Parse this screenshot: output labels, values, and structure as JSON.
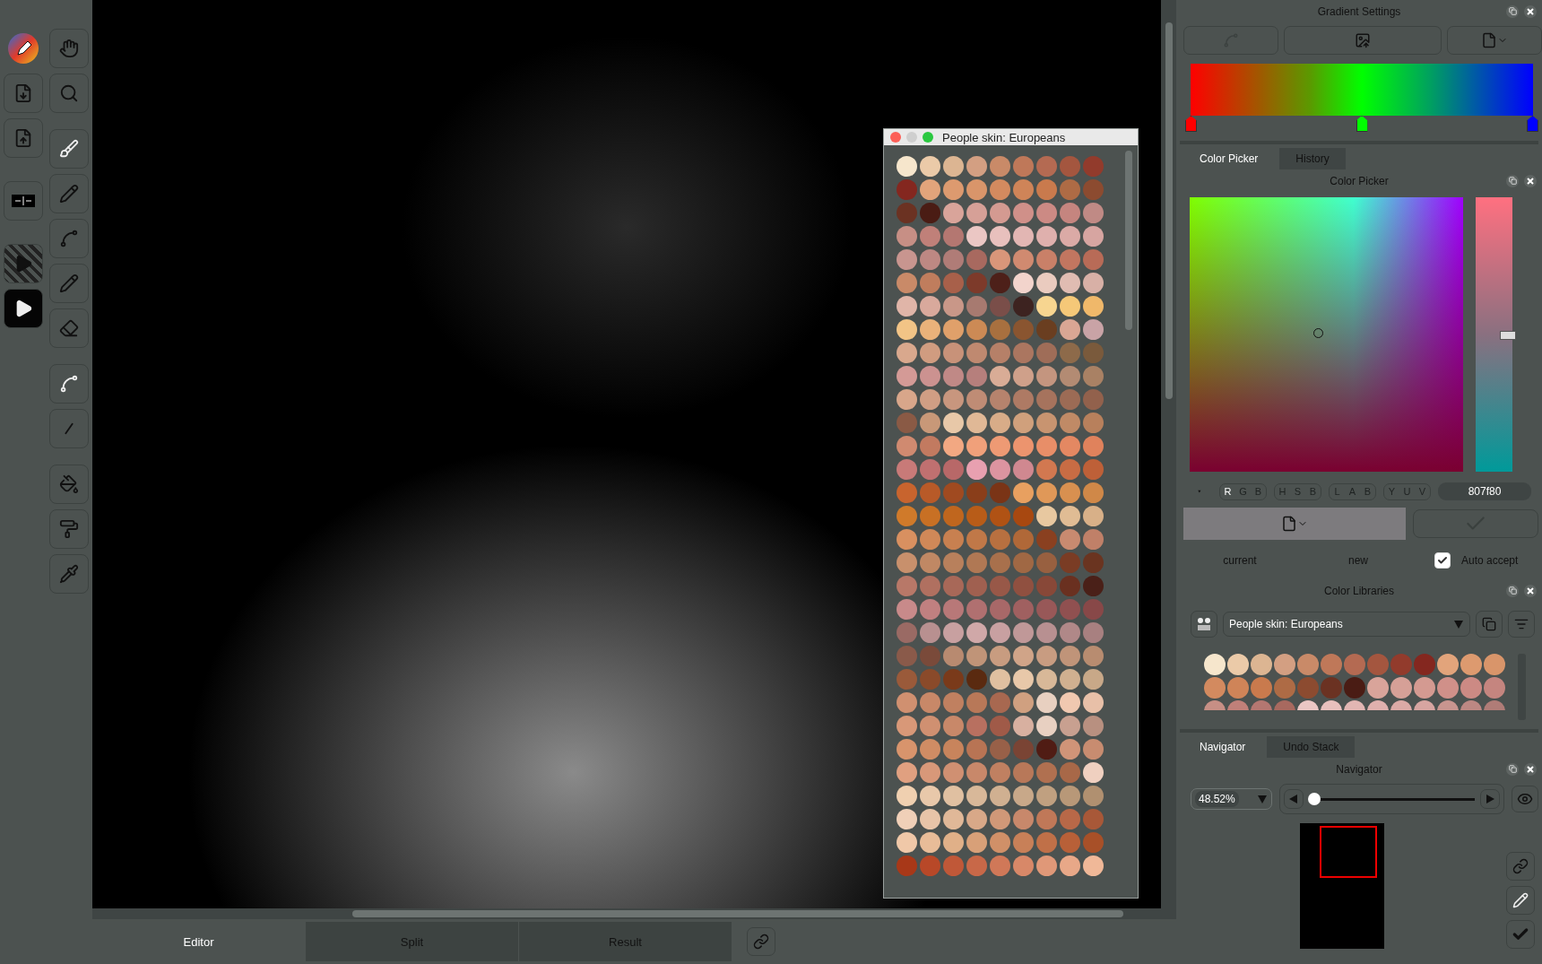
{
  "palette_window": {
    "title": "People skin: Europeans",
    "swatches": [
      {
        "color": "#f6e6cc"
      },
      {
        "color": "#ebcaa8"
      },
      {
        "color": "#dcb592"
      },
      {
        "color": "#d39f82"
      },
      {
        "color": "#c98a68"
      },
      {
        "color": "#bf7859"
      },
      {
        "color": "#b46a52"
      },
      {
        "color": "#a4563f"
      },
      {
        "color": "#923b2c"
      },
      {
        "color": "#84271f"
      },
      {
        "color": "#e2a47b"
      },
      {
        "color": "#dd9a6f"
      },
      {
        "color": "#d9956a"
      },
      {
        "color": "#d38a5f"
      },
      {
        "color": "#cf8458"
      },
      {
        "color": "#c97a4d"
      },
      {
        "color": "#ae6b45"
      },
      {
        "color": "#8c4b30"
      },
      {
        "color": "#6b3222"
      },
      {
        "color": "#4a1c14"
      },
      {
        "color": "#d9a49a"
      },
      {
        "color": "#d6a097"
      },
      {
        "color": "#d49a91"
      },
      {
        "color": "#d09089"
      },
      {
        "color": "#cc8a84"
      },
      {
        "color": "#c5857f"
      },
      {
        "color": "#c08a85"
      },
      {
        "color": "#c78f85"
      },
      {
        "color": "#c08079"
      },
      {
        "color": "#b47771"
      },
      {
        "color": "#ebc7c4"
      },
      {
        "color": "#e8c0bd"
      },
      {
        "color": "#e2b6b3"
      },
      {
        "color": "#dfb0ad"
      },
      {
        "color": "#dbaaa6"
      },
      {
        "color": "#d7a5a1"
      },
      {
        "color": "#c8958f"
      },
      {
        "color": "#bd8883"
      },
      {
        "color": "#b07c77"
      },
      {
        "color": "#a8695f"
      },
      {
        "color": "#d9967a"
      },
      {
        "color": "#d08a70"
      },
      {
        "color": "#c98068"
      },
      {
        "color": "#c27660"
      },
      {
        "color": "#b86b57"
      },
      {
        "color": "#c98a68"
      },
      {
        "color": "#c07d5d"
      },
      {
        "color": "#a8604a"
      },
      {
        "color": "#7d3a2a"
      },
      {
        "color": "#4d2019"
      },
      {
        "color": "#f2d4cc"
      },
      {
        "color": "#eacbbf"
      },
      {
        "color": "#e0bcb2"
      },
      {
        "color": "#d8b0a6"
      },
      {
        "color": "#e0b5a8"
      },
      {
        "color": "#d9a99c"
      },
      {
        "color": "#c99788"
      },
      {
        "color": "#a77a70"
      },
      {
        "color": "#7a4e49"
      },
      {
        "color": "#3d2320"
      },
      {
        "color": "#f7d590"
      },
      {
        "color": "#f5c878"
      },
      {
        "color": "#f0b86a"
      },
      {
        "color": "#f2c486"
      },
      {
        "color": "#eab27a"
      },
      {
        "color": "#e0a06a"
      },
      {
        "color": "#cc8a55"
      },
      {
        "color": "#a8703f"
      },
      {
        "color": "#8a5530"
      },
      {
        "color": "#6a3e20"
      },
      {
        "color": "#d9a694"
      },
      {
        "color": "#c9a3a6"
      },
      {
        "color": "#d9a88d"
      },
      {
        "color": "#d09c80"
      },
      {
        "color": "#c89279"
      },
      {
        "color": "#bf8970"
      },
      {
        "color": "#b68068"
      },
      {
        "color": "#ab7660"
      },
      {
        "color": "#9f6d58"
      },
      {
        "color": "#8d6a4a"
      },
      {
        "color": "#7a5a3c"
      },
      {
        "color": "#d49a96"
      },
      {
        "color": "#cc9290"
      },
      {
        "color": "#c08986"
      },
      {
        "color": "#b67f7c"
      },
      {
        "color": "#d9ac96"
      },
      {
        "color": "#cfa08a"
      },
      {
        "color": "#c4957f"
      },
      {
        "color": "#b38b73"
      },
      {
        "color": "#a98164"
      },
      {
        "color": "#d8a68a"
      },
      {
        "color": "#d09e84"
      },
      {
        "color": "#c8967e"
      },
      {
        "color": "#bf8c75"
      },
      {
        "color": "#b6836d"
      },
      {
        "color": "#ae7a64"
      },
      {
        "color": "#a6735d"
      },
      {
        "color": "#9c6b55"
      },
      {
        "color": "#92614c"
      },
      {
        "color": "#8a5a45"
      },
      {
        "color": "#c89878"
      },
      {
        "color": "#e8c8a8"
      },
      {
        "color": "#e0b896"
      },
      {
        "color": "#d8ac88"
      },
      {
        "color": "#d0a07c"
      },
      {
        "color": "#c89470"
      },
      {
        "color": "#c08a66"
      },
      {
        "color": "#b8805c"
      },
      {
        "color": "#d08a70"
      },
      {
        "color": "#c27a60"
      },
      {
        "color": "#f2a882"
      },
      {
        "color": "#f0a07a"
      },
      {
        "color": "#ee9a74"
      },
      {
        "color": "#ec946e"
      },
      {
        "color": "#e88e68"
      },
      {
        "color": "#e48862"
      },
      {
        "color": "#e0825c"
      },
      {
        "color": "#c87a78"
      },
      {
        "color": "#c07070"
      },
      {
        "color": "#b86868"
      },
      {
        "color": "#e8a0b0"
      },
      {
        "color": "#dc94a0"
      },
      {
        "color": "#d08890"
      },
      {
        "color": "#d27850"
      },
      {
        "color": "#c86c44"
      },
      {
        "color": "#be6038"
      },
      {
        "color": "#c8642e"
      },
      {
        "color": "#b85a28"
      },
      {
        "color": "#a04a20"
      },
      {
        "color": "#8a3e1a"
      },
      {
        "color": "#7a3416"
      },
      {
        "color": "#e8a060"
      },
      {
        "color": "#e09858"
      },
      {
        "color": "#d89050"
      },
      {
        "color": "#d08848"
      },
      {
        "color": "#d07a2a"
      },
      {
        "color": "#c87024"
      },
      {
        "color": "#c0661e"
      },
      {
        "color": "#b85c18"
      },
      {
        "color": "#b05214"
      },
      {
        "color": "#a84810"
      },
      {
        "color": "#e8c8a0"
      },
      {
        "color": "#e0bc94"
      },
      {
        "color": "#d8b088"
      },
      {
        "color": "#d89060"
      },
      {
        "color": "#d08858"
      },
      {
        "color": "#c88050"
      },
      {
        "color": "#c07848"
      },
      {
        "color": "#b87040"
      },
      {
        "color": "#b06838"
      },
      {
        "color": "#8a4020"
      },
      {
        "color": "#c88a70"
      },
      {
        "color": "#c08068"
      },
      {
        "color": "#c8906c"
      },
      {
        "color": "#c08864"
      },
      {
        "color": "#b8805c"
      },
      {
        "color": "#b07854"
      },
      {
        "color": "#a8704c"
      },
      {
        "color": "#a06844"
      },
      {
        "color": "#986040"
      },
      {
        "color": "#7a3c24"
      },
      {
        "color": "#6a3420"
      },
      {
        "color": "#b87868"
      },
      {
        "color": "#b07060"
      },
      {
        "color": "#a86858"
      },
      {
        "color": "#a06050"
      },
      {
        "color": "#985848"
      },
      {
        "color": "#905040"
      },
      {
        "color": "#884838"
      },
      {
        "color": "#6a3020"
      },
      {
        "color": "#4a2018"
      },
      {
        "color": "#c88a8a"
      },
      {
        "color": "#c08080"
      },
      {
        "color": "#b87878"
      },
      {
        "color": "#b07070"
      },
      {
        "color": "#a86868"
      },
      {
        "color": "#a06060"
      },
      {
        "color": "#985858"
      },
      {
        "color": "#905050"
      },
      {
        "color": "#884848"
      },
      {
        "color": "#9a6a64"
      },
      {
        "color": "#b89090"
      },
      {
        "color": "#c8a0a0"
      },
      {
        "color": "#d0a8a8"
      },
      {
        "color": "#c8a0a1"
      },
      {
        "color": "#c09898"
      },
      {
        "color": "#b89091"
      },
      {
        "color": "#b08888"
      },
      {
        "color": "#a88080"
      },
      {
        "color": "#8a5a4a"
      },
      {
        "color": "#7a4a3a"
      },
      {
        "color": "#b88a70"
      },
      {
        "color": "#c09478"
      },
      {
        "color": "#c89c80"
      },
      {
        "color": "#d0a488"
      },
      {
        "color": "#c89c81"
      },
      {
        "color": "#c09479"
      },
      {
        "color": "#b88c70"
      },
      {
        "color": "#9a5a3a"
      },
      {
        "color": "#8a4a2a"
      },
      {
        "color": "#7a3a1a"
      },
      {
        "color": "#5a2a10"
      },
      {
        "color": "#e0c0a0"
      },
      {
        "color": "#e8c8a9"
      },
      {
        "color": "#d8b898"
      },
      {
        "color": "#d0b090"
      },
      {
        "color": "#c8a888"
      },
      {
        "color": "#d09070"
      },
      {
        "color": "#c88868"
      },
      {
        "color": "#c08060"
      },
      {
        "color": "#b87858"
      },
      {
        "color": "#a86850"
      },
      {
        "color": "#d0a080"
      },
      {
        "color": "#e8d0c0"
      },
      {
        "color": "#f0c8b0"
      },
      {
        "color": "#e8c0a8"
      },
      {
        "color": "#d89878"
      },
      {
        "color": "#d09071"
      },
      {
        "color": "#c88869"
      },
      {
        "color": "#b87060"
      },
      {
        "color": "#a05a48"
      },
      {
        "color": "#d8b0a0"
      },
      {
        "color": "#e8d0c1"
      },
      {
        "color": "#c8a090"
      },
      {
        "color": "#b89080"
      },
      {
        "color": "#d8946c"
      },
      {
        "color": "#d08c64"
      },
      {
        "color": "#c8845c"
      },
      {
        "color": "#b87454"
      },
      {
        "color": "#986048"
      },
      {
        "color": "#7a4434"
      },
      {
        "color": "#501c14"
      },
      {
        "color": "#d09478"
      },
      {
        "color": "#c88c70"
      },
      {
        "color": "#e0a080"
      },
      {
        "color": "#d89879"
      },
      {
        "color": "#d09072"
      },
      {
        "color": "#c8886a"
      },
      {
        "color": "#c08061"
      },
      {
        "color": "#b87859"
      },
      {
        "color": "#b07050"
      },
      {
        "color": "#a86848"
      },
      {
        "color": "#f0d0c0"
      },
      {
        "color": "#f0d0b0"
      },
      {
        "color": "#e8c8aa"
      },
      {
        "color": "#e0c0a1"
      },
      {
        "color": "#d8b899"
      },
      {
        "color": "#d0b091"
      },
      {
        "color": "#c8a889"
      },
      {
        "color": "#c0a080"
      },
      {
        "color": "#b89878"
      },
      {
        "color": "#b09070"
      },
      {
        "color": "#f0d0b8"
      },
      {
        "color": "#e8c4a8"
      },
      {
        "color": "#e0b898"
      },
      {
        "color": "#d8a888"
      },
      {
        "color": "#d09878"
      },
      {
        "color": "#c8886b"
      },
      {
        "color": "#c07858"
      },
      {
        "color": "#b86848"
      },
      {
        "color": "#a85838"
      },
      {
        "color": "#f0c8a8"
      },
      {
        "color": "#e8bc98"
      },
      {
        "color": "#e0b088"
      },
      {
        "color": "#d8a078"
      },
      {
        "color": "#d09068"
      },
      {
        "color": "#c88058"
      },
      {
        "color": "#c07048"
      },
      {
        "color": "#b86038"
      },
      {
        "color": "#a85028"
      },
      {
        "color": "#a83818"
      },
      {
        "color": "#b84828"
      },
      {
        "color": "#c05838"
      },
      {
        "color": "#c86848"
      },
      {
        "color": "#d07858"
      },
      {
        "color": "#d88868"
      },
      {
        "color": "#e09878"
      },
      {
        "color": "#e8a888"
      },
      {
        "color": "#f0b898"
      }
    ]
  },
  "view_tabs": [
    {
      "label": "Editor",
      "selected": true
    },
    {
      "label": "Split",
      "selected": false
    },
    {
      "label": "Result",
      "selected": false
    }
  ],
  "gradient_settings": {
    "title": "Gradient Settings",
    "stops": [
      {
        "color": "#ff0000"
      },
      {
        "color": "#00ff00"
      },
      {
        "color": "#0000ff"
      }
    ]
  },
  "color_panel": {
    "tabs": [
      {
        "label": "Color Picker",
        "selected": true
      },
      {
        "label": "History",
        "selected": false
      }
    ],
    "title": "Color Picker",
    "hue_slider": {
      "level": 0.5
    },
    "channel_groups": [
      [
        {
          "label": "R",
          "selected": true
        },
        {
          "label": "G",
          "selected": false
        },
        {
          "label": "B",
          "selected": false
        }
      ],
      [
        {
          "label": "H",
          "selected": false
        },
        {
          "label": "S",
          "selected": false
        },
        {
          "label": "B",
          "selected": false
        }
      ],
      [
        {
          "label": "L",
          "selected": false
        },
        {
          "label": "A",
          "selected": false
        },
        {
          "label": "B",
          "selected": false
        }
      ],
      [
        {
          "label": "Y",
          "selected": false
        },
        {
          "label": "U",
          "selected": false
        },
        {
          "label": "V",
          "selected": false
        }
      ]
    ],
    "hex_value": "807f80",
    "current_label": "current",
    "new_label": "new",
    "auto_accept": {
      "label": "Auto accept",
      "checked": true
    }
  },
  "color_libraries": {
    "title": "Color Libraries",
    "library": "People skin: Europeans",
    "swatches": [
      {
        "color": "#f6e6cc"
      },
      {
        "color": "#ebcaa8"
      },
      {
        "color": "#dcb592"
      },
      {
        "color": "#d39f82"
      },
      {
        "color": "#c98a68"
      },
      {
        "color": "#bf7859"
      },
      {
        "color": "#b46a52"
      },
      {
        "color": "#a4563f"
      },
      {
        "color": "#923b2c"
      },
      {
        "color": "#84271f"
      },
      {
        "color": "#e2a47b"
      },
      {
        "color": "#dd9a6f"
      },
      {
        "color": "#d9956a"
      },
      {
        "color": "#d38a5f"
      },
      {
        "color": "#cf8458"
      },
      {
        "color": "#c97a4d"
      },
      {
        "color": "#ae6b45"
      },
      {
        "color": "#8c4b30"
      },
      {
        "color": "#6b3222"
      },
      {
        "color": "#4a1c14"
      },
      {
        "color": "#d9a49a"
      },
      {
        "color": "#d6a097"
      },
      {
        "color": "#d49a91"
      },
      {
        "color": "#d09089"
      },
      {
        "color": "#cc8a84"
      },
      {
        "color": "#c5857f"
      },
      {
        "color": "#c78f85"
      },
      {
        "color": "#c08079"
      },
      {
        "color": "#b47771"
      },
      {
        "color": "#a8695f"
      },
      {
        "color": "#ebc7c4"
      },
      {
        "color": "#e8c0bd"
      },
      {
        "color": "#e2b6b3"
      },
      {
        "color": "#dfb0ad"
      },
      {
        "color": "#dbaaa6"
      },
      {
        "color": "#d7a5a1"
      },
      {
        "color": "#c8958f"
      },
      {
        "color": "#bd8883"
      },
      {
        "color": "#b07c77"
      }
    ]
  },
  "navigator": {
    "tabs": [
      {
        "label": "Navigator",
        "selected": true
      },
      {
        "label": "Undo Stack",
        "selected": false
      }
    ],
    "title": "Navigator",
    "zoom": "48.52%",
    "zoom_slider": {
      "level": 0.03
    }
  }
}
